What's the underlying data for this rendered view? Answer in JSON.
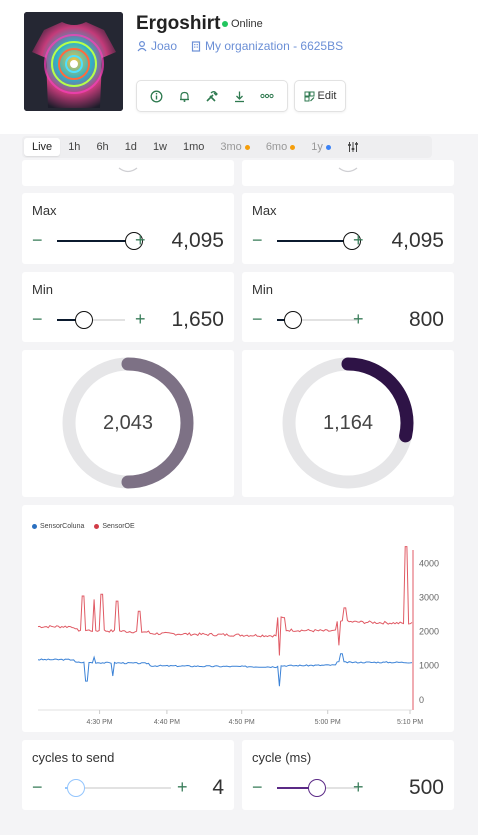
{
  "device": {
    "name": "Ergoshirt",
    "status": "Online",
    "owner": "Joao",
    "organization": "My organization - 6625BS"
  },
  "toolbar": {
    "icons": [
      "info-icon",
      "bell-icon",
      "tools-icon",
      "download-icon",
      "more-icon"
    ],
    "edit_label": "Edit"
  },
  "time_ranges": [
    {
      "label": "Live",
      "active": true
    },
    {
      "label": "1h"
    },
    {
      "label": "6h"
    },
    {
      "label": "1d"
    },
    {
      "label": "1w"
    },
    {
      "label": "1mo"
    },
    {
      "label": "3mo",
      "badge": "orange"
    },
    {
      "label": "6mo",
      "badge": "orange"
    },
    {
      "label": "1y",
      "badge": "blue"
    }
  ],
  "sliders": {
    "max_left": {
      "label": "Max",
      "value": "4,095",
      "level": 1.0,
      "color": "#0b1a2e"
    },
    "max_right": {
      "label": "Max",
      "value": "4,095",
      "level": 1.0,
      "color": "#0b1a2e"
    },
    "min_left": {
      "label": "Min",
      "value": "1,650",
      "level": 0.4,
      "color": "#0b1a2e"
    },
    "min_right": {
      "label": "Min",
      "value": "800",
      "level": 0.2,
      "color": "#0b1a2e"
    },
    "cycles": {
      "label": "cycles to send",
      "value": "4",
      "level": 0.1,
      "color": "#93c5fd"
    },
    "cycle_ms": {
      "label": "cycle (ms)",
      "value": "500",
      "level": 0.5,
      "color": "#5b2a86"
    }
  },
  "gauges": {
    "left": {
      "value": "2,043",
      "fraction": 0.5,
      "color": "#7d7185"
    },
    "right": {
      "value": "1,164",
      "fraction": 0.285,
      "color": "#2e1346"
    }
  },
  "chart_data": {
    "type": "line",
    "series": [
      {
        "name": "SensorColuna",
        "color": "#2a6fbf"
      },
      {
        "name": "SensorOE",
        "color": "#d13b47"
      }
    ],
    "x_ticks": [
      "4:30 PM",
      "4:40 PM",
      "4:50 PM",
      "5:00 PM",
      "5:10 PM"
    ],
    "y_ticks": [
      "4000",
      "3000",
      "2000",
      "1000",
      "0"
    ],
    "ylim": [
      -300,
      4400
    ],
    "y_axis": "right",
    "grid": false,
    "legend": "top-left"
  }
}
